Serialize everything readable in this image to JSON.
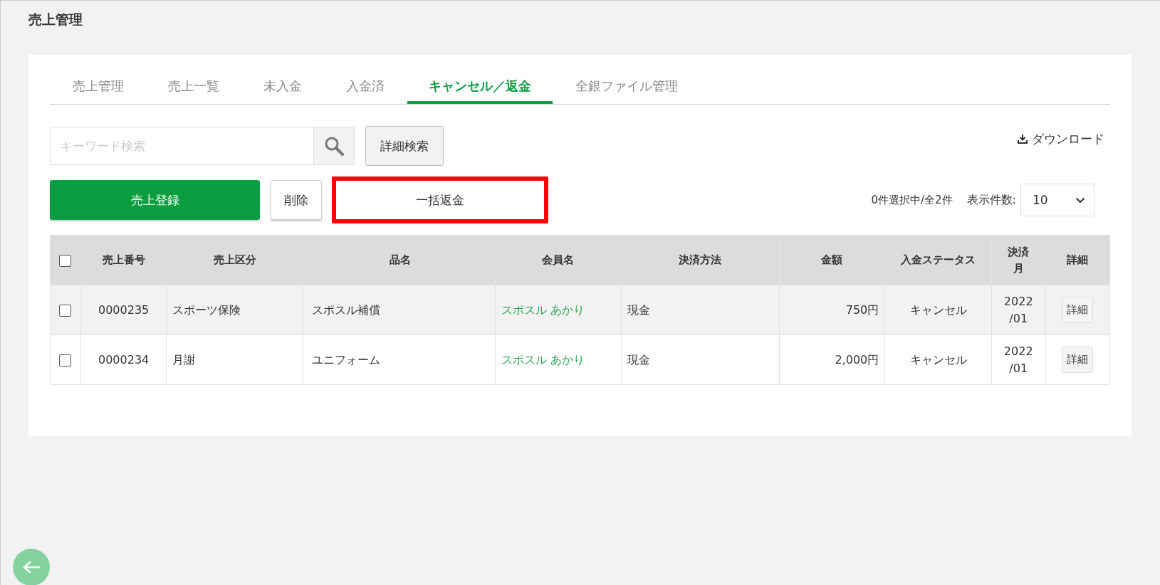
{
  "page_title": "売上管理",
  "tabs": [
    {
      "label": "売上管理",
      "selected": false
    },
    {
      "label": "売上一覧",
      "selected": false
    },
    {
      "label": "未入金",
      "selected": false
    },
    {
      "label": "入金済",
      "selected": false
    },
    {
      "label": "キャンセル／返金",
      "selected": true
    },
    {
      "label": "全銀ファイル管理",
      "selected": false
    }
  ],
  "search": {
    "placeholder": "キーワード検索"
  },
  "advanced_search_button": "詳細検索",
  "download_link": "ダウンロード",
  "actions": [
    {
      "label": "売上登録",
      "kind": "primary",
      "outlined": false
    },
    {
      "label": "削除",
      "kind": "secondary",
      "outlined": false
    },
    {
      "label": "一括返金",
      "kind": "wide",
      "outlined": true
    }
  ],
  "selection_count": "0件選択中/全2件",
  "page_size": {
    "label": "表示件数:",
    "value": "10"
  },
  "table": {
    "header_checked": false,
    "columns": [
      "売上番号",
      "売上区分",
      "品名",
      "会員名",
      "決済方法",
      "金額",
      "入金ステータス",
      "決済月",
      "詳細"
    ],
    "rows": [
      {
        "checked": false,
        "highlighted": true,
        "cells": [
          "0000235",
          "スポーツ保険",
          "スポスル補償",
          "スポスル あかり",
          "現金",
          "750円",
          "キャンセル",
          "2022\n/01"
        ],
        "detail_button": "詳細"
      },
      {
        "checked": false,
        "highlighted": false,
        "cells": [
          "0000234",
          "月謝",
          "ユニフォーム",
          "スポスル あかり",
          "現金",
          "2,000円",
          "キャンセル",
          "2022\n/01"
        ],
        "detail_button": "詳細"
      }
    ]
  }
}
